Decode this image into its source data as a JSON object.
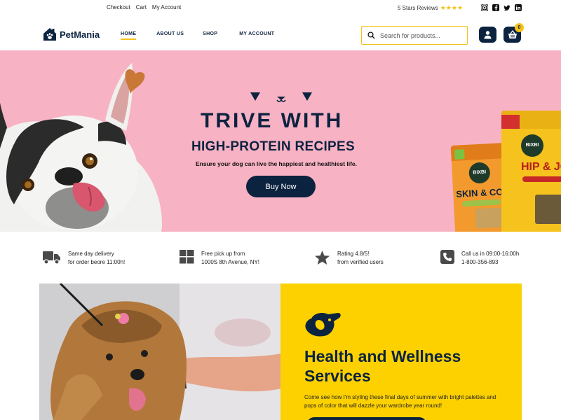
{
  "topbar": {
    "links": [
      "Checkout",
      "Cart",
      "My Account"
    ],
    "reviews_label": "5 Stars Reviews",
    "reviews_stars": "★★★★",
    "socials": [
      "instagram-icon",
      "facebook-icon",
      "twitter-icon",
      "linkedin-icon"
    ]
  },
  "brand": {
    "name": "PetMania"
  },
  "nav": {
    "items": [
      {
        "label": "HOME",
        "active": true
      },
      {
        "label": "ABOUT US",
        "active": false
      },
      {
        "label": "SHOP",
        "active": false
      },
      {
        "label": "MY ACCOUNT",
        "active": false
      }
    ]
  },
  "search": {
    "placeholder": "Search for products..."
  },
  "cart": {
    "count": "0"
  },
  "hero": {
    "title": "TRIVE WITH",
    "subtitle": "HIGH-PROTEIN RECIPES",
    "description": "Ensure your dog can live the happiest and healthiest life.",
    "cta": "Buy Now",
    "packs": [
      {
        "brand": "BIXBI",
        "name": "SKIN & COA"
      },
      {
        "brand": "BIXBI",
        "name": "HIP & JO"
      }
    ]
  },
  "features": [
    {
      "icon": "truck-icon",
      "line1": "Same day delivery",
      "line2": "for order beore 11:00h!"
    },
    {
      "icon": "grid-icon",
      "line1": "Free pick up from",
      "line2": "1000S 8th Avenue, NY!"
    },
    {
      "icon": "star-icon",
      "line1": "Rating 4.8/5!",
      "line2": "from verified users"
    },
    {
      "icon": "phone-icon",
      "line1": "Call us in 09:00-16:00h",
      "line2": "1-800-356-893"
    }
  ],
  "services": {
    "title": "Health and Wellness Services",
    "description": "Come see how I'm styling these final days of summer with bright palettes and pops of color that will dazzle your wardrobe year round!"
  },
  "colors": {
    "navy": "#0c2340",
    "yellow": "#fdd100",
    "pink": "#f7b2c4"
  }
}
